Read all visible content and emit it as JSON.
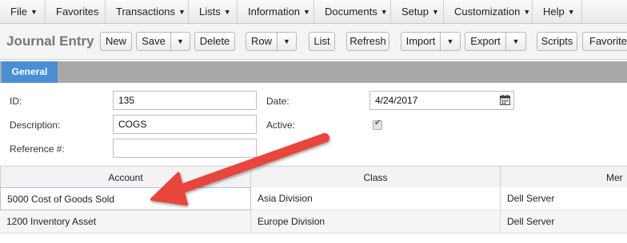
{
  "menu": {
    "items": [
      {
        "label": "File",
        "id": "file"
      },
      {
        "label": "Favorites",
        "id": "favorites"
      },
      {
        "label": "Transactions",
        "id": "transactions"
      },
      {
        "label": "Lists",
        "id": "lists"
      },
      {
        "label": "Information",
        "id": "information"
      },
      {
        "label": "Documents",
        "id": "documents"
      },
      {
        "label": "Setup",
        "id": "setup"
      },
      {
        "label": "Customization",
        "id": "customization"
      },
      {
        "label": "Help",
        "id": "help"
      }
    ]
  },
  "toolbar": {
    "title": "Journal Entry",
    "new_label": "New",
    "save_label": "Save",
    "delete_label": "Delete",
    "row_label": "Row",
    "list_label": "List",
    "refresh_label": "Refresh",
    "import_label": "Import",
    "export_label": "Export",
    "scripts_label": "Scripts",
    "favorite_label": "Favorite"
  },
  "tabs": {
    "general": "General"
  },
  "form": {
    "id_label": "ID:",
    "id_value": "135",
    "description_label": "Description:",
    "description_value": "COGS",
    "reference_label": "Reference #:",
    "reference_value": "",
    "date_label": "Date:",
    "date_value": "4/24/2017",
    "active_label": "Active:",
    "active_checked": true
  },
  "grid": {
    "columns": [
      "Account",
      "Class",
      "Mer"
    ],
    "rows": [
      {
        "account": "5000 Cost of Goods Sold",
        "class": "Asia Division",
        "merchant": "Dell Server"
      },
      {
        "account": "1200 Inventory Asset",
        "class": "Europe Division",
        "merchant": "Dell Server"
      }
    ]
  },
  "colors": {
    "tab_active": "#4a8fd3",
    "annotation_arrow": "#e8453c"
  },
  "icons": {
    "menu_caret": "caret-down-icon",
    "date_picker": "calendar-icon",
    "active_check": "checkmark-icon",
    "annotation": "arrow-annotation"
  }
}
